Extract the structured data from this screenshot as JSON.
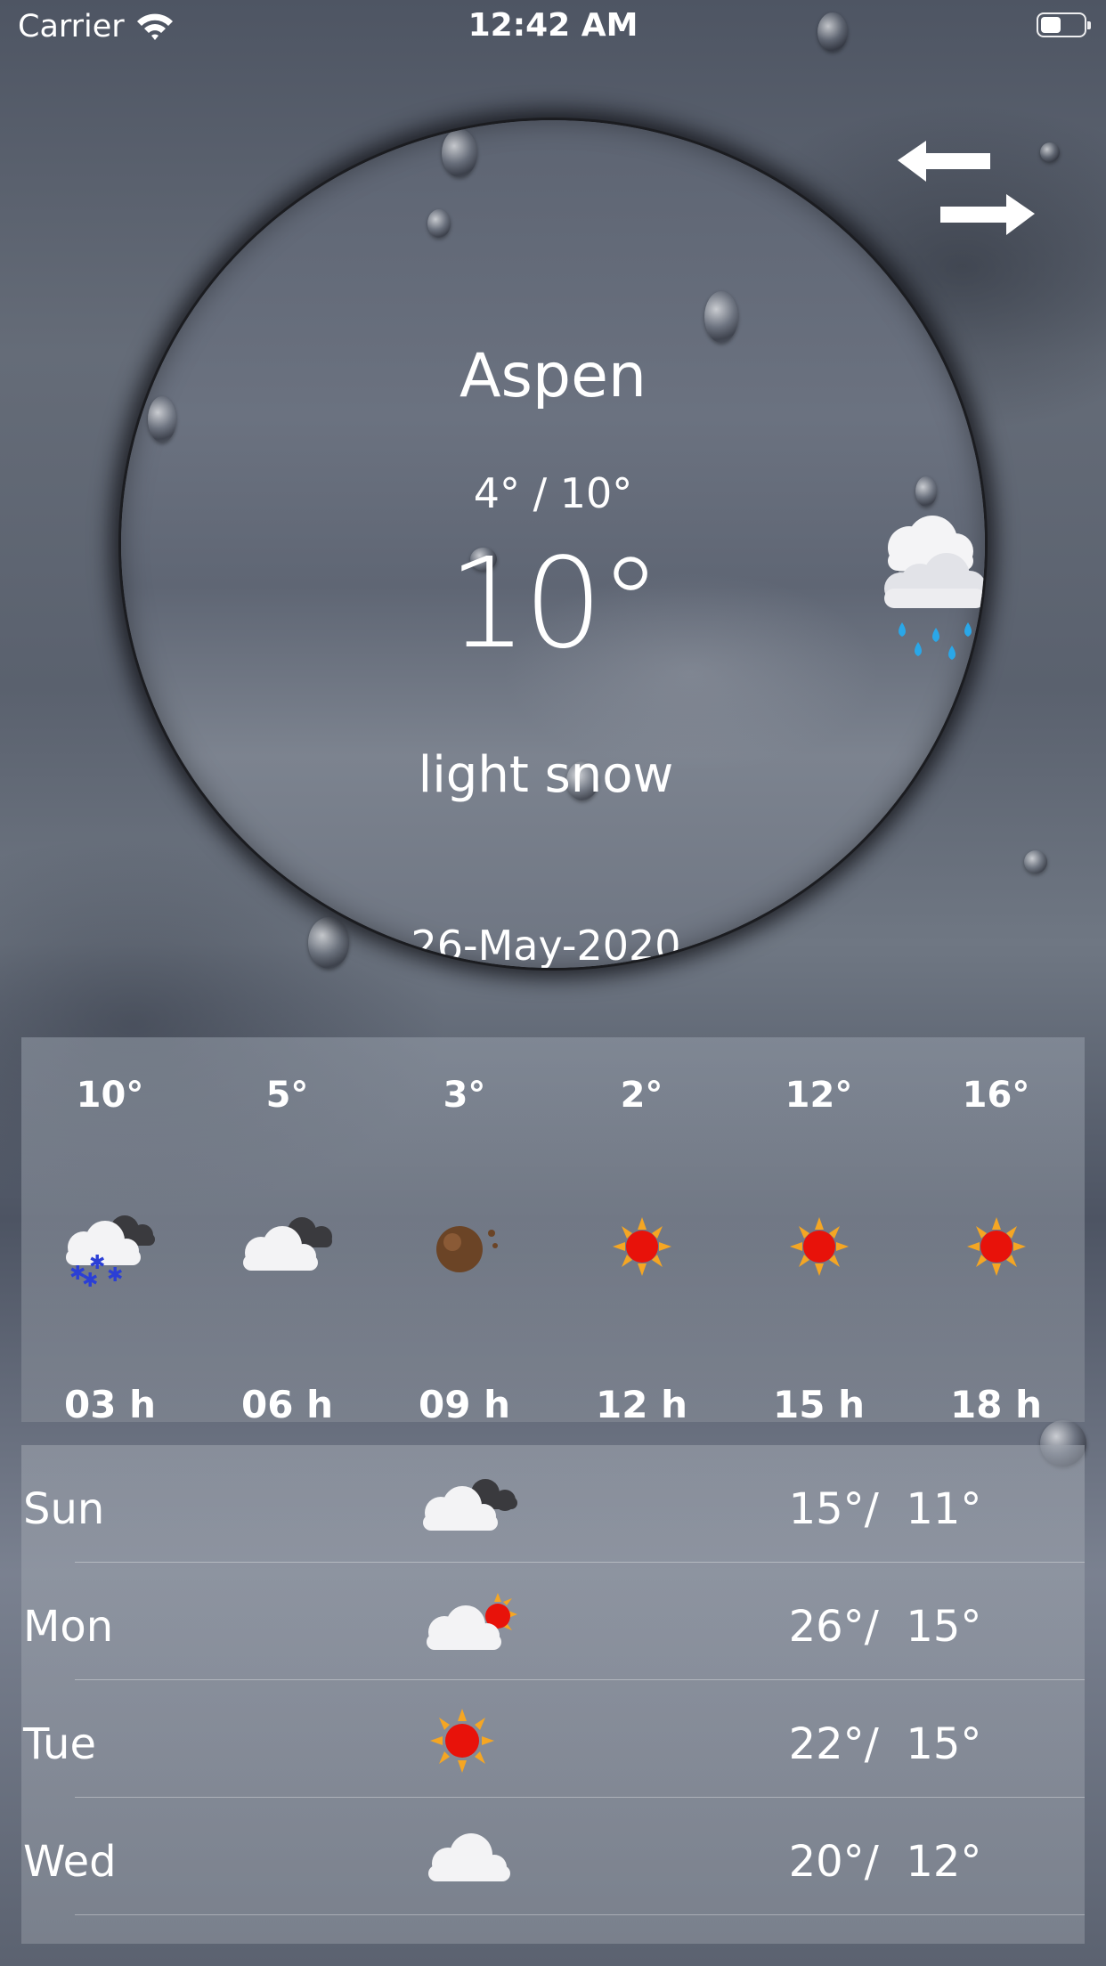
{
  "status_bar": {
    "carrier": "Carrier",
    "time": "12:42 AM"
  },
  "current": {
    "city": "Aspen",
    "temp_range": "4° / 10°",
    "temp": "10°",
    "condition": "light snow",
    "date": "26-May-2020",
    "icon": "cloud-rain-icon"
  },
  "hourly": [
    {
      "temp": "10°",
      "time": "03 h",
      "icon": "snow-cloud-icon"
    },
    {
      "temp": "5°",
      "time": "06 h",
      "icon": "cloudy-icon"
    },
    {
      "temp": "3°",
      "time": "09 h",
      "icon": "meteor-icon"
    },
    {
      "temp": "2°",
      "time": "12 h",
      "icon": "sun-icon"
    },
    {
      "temp": "12°",
      "time": "15 h",
      "icon": "sun-icon"
    },
    {
      "temp": "16°",
      "time": "18 h",
      "icon": "sun-icon"
    }
  ],
  "daily": [
    {
      "day": "Sun",
      "temps": "15°/  11°",
      "icon": "cloudy-icon"
    },
    {
      "day": "Mon",
      "temps": "26°/  15°",
      "icon": "partly-sunny-icon"
    },
    {
      "day": "Tue",
      "temps": "22°/  15°",
      "icon": "sun-icon"
    },
    {
      "day": "Wed",
      "temps": "20°/  12°",
      "icon": "cloud-icon"
    }
  ],
  "colors": {
    "sun_core": "#e8120a",
    "sun_ray": "#f5a623",
    "rain": "#2aa7e8",
    "snowflake": "#2b3fd6"
  }
}
